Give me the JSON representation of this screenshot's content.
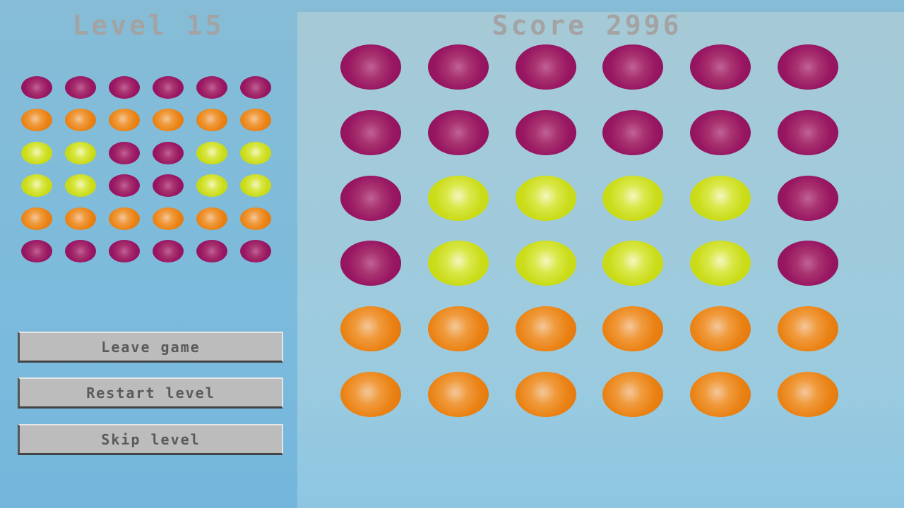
{
  "header": {
    "level_label": "Level 15",
    "score_label": "Score 2996"
  },
  "colors": {
    "P": "#991763",
    "O": "#ea8214",
    "Y": "#cbdc1a"
  },
  "target_board": [
    [
      "P",
      "P",
      "P",
      "P",
      "P",
      "P"
    ],
    [
      "O",
      "O",
      "O",
      "O",
      "O",
      "O"
    ],
    [
      "Y",
      "Y",
      "P",
      "P",
      "Y",
      "Y"
    ],
    [
      "Y",
      "Y",
      "P",
      "P",
      "Y",
      "Y"
    ],
    [
      "O",
      "O",
      "O",
      "O",
      "O",
      "O"
    ],
    [
      "P",
      "P",
      "P",
      "P",
      "P",
      "P"
    ]
  ],
  "game_board": [
    [
      "P",
      "P",
      "P",
      "P",
      "P",
      "P"
    ],
    [
      "P",
      "P",
      "P",
      "P",
      "P",
      "P"
    ],
    [
      "P",
      "Y",
      "Y",
      "Y",
      "Y",
      "P"
    ],
    [
      "P",
      "Y",
      "Y",
      "Y",
      "Y",
      "P"
    ],
    [
      "O",
      "O",
      "O",
      "O",
      "O",
      "O"
    ],
    [
      "O",
      "O",
      "O",
      "O",
      "O",
      "O"
    ]
  ],
  "buttons": {
    "leave": "Leave game",
    "restart": "Restart level",
    "skip": "Skip level"
  }
}
